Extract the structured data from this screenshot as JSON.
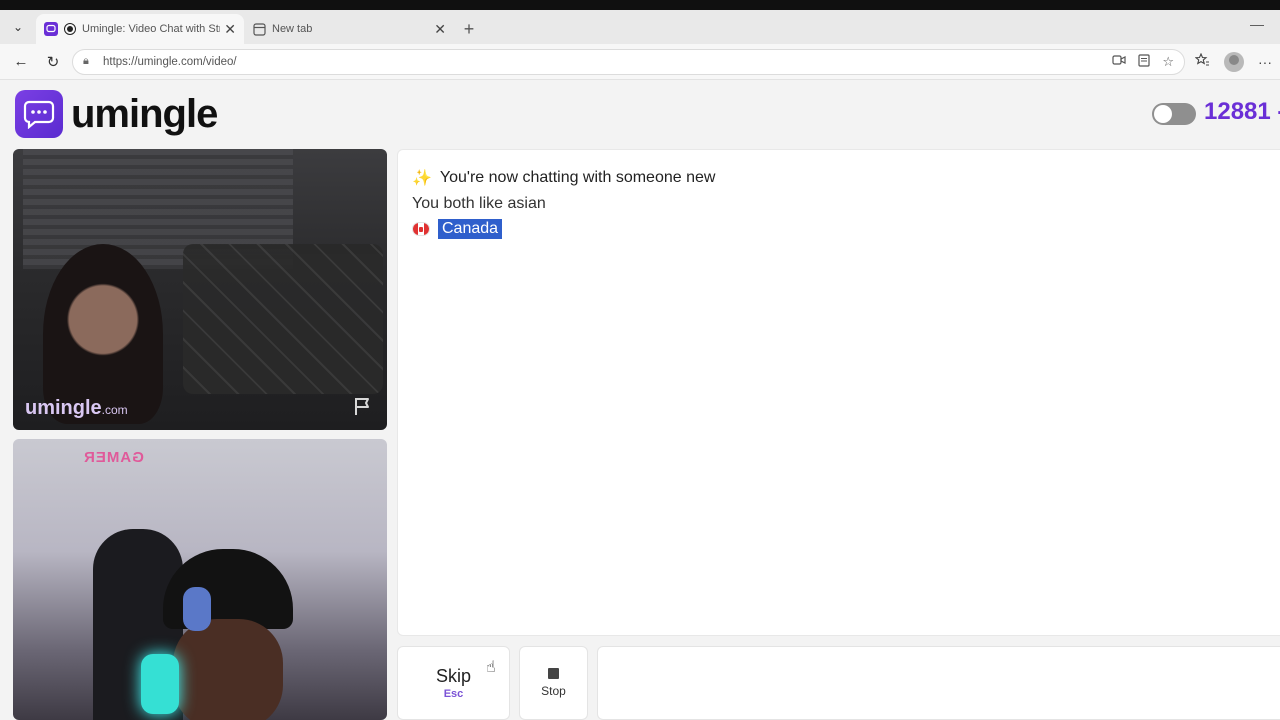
{
  "browser": {
    "tabs": [
      {
        "title": "Umingle: Video Chat with Stra",
        "active": true
      },
      {
        "title": "New tab",
        "active": false
      }
    ],
    "url": "https://umingle.com/video/"
  },
  "site": {
    "logo_text": "umingle",
    "online_count": "12881 -",
    "accent_color": "#6a2fd6"
  },
  "videos": {
    "watermark_main": "umingle",
    "watermark_suffix": ".com",
    "room_sign": "GAMER"
  },
  "chat": {
    "messages": [
      "You're now chatting with someone new",
      "You both like asian"
    ],
    "country": "Canada"
  },
  "controls": {
    "skip_label": "Skip",
    "skip_shortcut": "Esc",
    "stop_label": "Stop"
  }
}
